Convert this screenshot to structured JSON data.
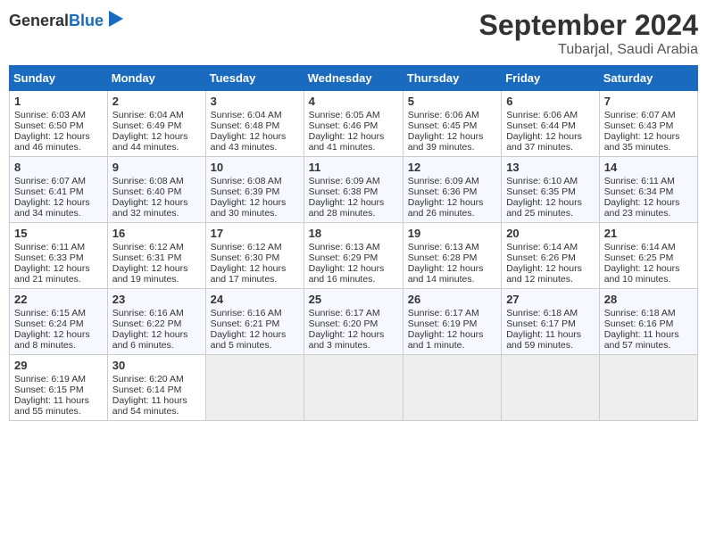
{
  "header": {
    "logo_general": "General",
    "logo_blue": "Blue",
    "month_title": "September 2024",
    "location": "Tubarjal, Saudi Arabia"
  },
  "calendar": {
    "days_of_week": [
      "Sunday",
      "Monday",
      "Tuesday",
      "Wednesday",
      "Thursday",
      "Friday",
      "Saturday"
    ],
    "weeks": [
      [
        {
          "day": 1,
          "sunrise": "Sunrise: 6:03 AM",
          "sunset": "Sunset: 6:50 PM",
          "daylight": "Daylight: 12 hours and 46 minutes."
        },
        {
          "day": 2,
          "sunrise": "Sunrise: 6:04 AM",
          "sunset": "Sunset: 6:49 PM",
          "daylight": "Daylight: 12 hours and 44 minutes."
        },
        {
          "day": 3,
          "sunrise": "Sunrise: 6:04 AM",
          "sunset": "Sunset: 6:48 PM",
          "daylight": "Daylight: 12 hours and 43 minutes."
        },
        {
          "day": 4,
          "sunrise": "Sunrise: 6:05 AM",
          "sunset": "Sunset: 6:46 PM",
          "daylight": "Daylight: 12 hours and 41 minutes."
        },
        {
          "day": 5,
          "sunrise": "Sunrise: 6:06 AM",
          "sunset": "Sunset: 6:45 PM",
          "daylight": "Daylight: 12 hours and 39 minutes."
        },
        {
          "day": 6,
          "sunrise": "Sunrise: 6:06 AM",
          "sunset": "Sunset: 6:44 PM",
          "daylight": "Daylight: 12 hours and 37 minutes."
        },
        {
          "day": 7,
          "sunrise": "Sunrise: 6:07 AM",
          "sunset": "Sunset: 6:43 PM",
          "daylight": "Daylight: 12 hours and 35 minutes."
        }
      ],
      [
        {
          "day": 8,
          "sunrise": "Sunrise: 6:07 AM",
          "sunset": "Sunset: 6:41 PM",
          "daylight": "Daylight: 12 hours and 34 minutes."
        },
        {
          "day": 9,
          "sunrise": "Sunrise: 6:08 AM",
          "sunset": "Sunset: 6:40 PM",
          "daylight": "Daylight: 12 hours and 32 minutes."
        },
        {
          "day": 10,
          "sunrise": "Sunrise: 6:08 AM",
          "sunset": "Sunset: 6:39 PM",
          "daylight": "Daylight: 12 hours and 30 minutes."
        },
        {
          "day": 11,
          "sunrise": "Sunrise: 6:09 AM",
          "sunset": "Sunset: 6:38 PM",
          "daylight": "Daylight: 12 hours and 28 minutes."
        },
        {
          "day": 12,
          "sunrise": "Sunrise: 6:09 AM",
          "sunset": "Sunset: 6:36 PM",
          "daylight": "Daylight: 12 hours and 26 minutes."
        },
        {
          "day": 13,
          "sunrise": "Sunrise: 6:10 AM",
          "sunset": "Sunset: 6:35 PM",
          "daylight": "Daylight: 12 hours and 25 minutes."
        },
        {
          "day": 14,
          "sunrise": "Sunrise: 6:11 AM",
          "sunset": "Sunset: 6:34 PM",
          "daylight": "Daylight: 12 hours and 23 minutes."
        }
      ],
      [
        {
          "day": 15,
          "sunrise": "Sunrise: 6:11 AM",
          "sunset": "Sunset: 6:33 PM",
          "daylight": "Daylight: 12 hours and 21 minutes."
        },
        {
          "day": 16,
          "sunrise": "Sunrise: 6:12 AM",
          "sunset": "Sunset: 6:31 PM",
          "daylight": "Daylight: 12 hours and 19 minutes."
        },
        {
          "day": 17,
          "sunrise": "Sunrise: 6:12 AM",
          "sunset": "Sunset: 6:30 PM",
          "daylight": "Daylight: 12 hours and 17 minutes."
        },
        {
          "day": 18,
          "sunrise": "Sunrise: 6:13 AM",
          "sunset": "Sunset: 6:29 PM",
          "daylight": "Daylight: 12 hours and 16 minutes."
        },
        {
          "day": 19,
          "sunrise": "Sunrise: 6:13 AM",
          "sunset": "Sunset: 6:28 PM",
          "daylight": "Daylight: 12 hours and 14 minutes."
        },
        {
          "day": 20,
          "sunrise": "Sunrise: 6:14 AM",
          "sunset": "Sunset: 6:26 PM",
          "daylight": "Daylight: 12 hours and 12 minutes."
        },
        {
          "day": 21,
          "sunrise": "Sunrise: 6:14 AM",
          "sunset": "Sunset: 6:25 PM",
          "daylight": "Daylight: 12 hours and 10 minutes."
        }
      ],
      [
        {
          "day": 22,
          "sunrise": "Sunrise: 6:15 AM",
          "sunset": "Sunset: 6:24 PM",
          "daylight": "Daylight: 12 hours and 8 minutes."
        },
        {
          "day": 23,
          "sunrise": "Sunrise: 6:16 AM",
          "sunset": "Sunset: 6:22 PM",
          "daylight": "Daylight: 12 hours and 6 minutes."
        },
        {
          "day": 24,
          "sunrise": "Sunrise: 6:16 AM",
          "sunset": "Sunset: 6:21 PM",
          "daylight": "Daylight: 12 hours and 5 minutes."
        },
        {
          "day": 25,
          "sunrise": "Sunrise: 6:17 AM",
          "sunset": "Sunset: 6:20 PM",
          "daylight": "Daylight: 12 hours and 3 minutes."
        },
        {
          "day": 26,
          "sunrise": "Sunrise: 6:17 AM",
          "sunset": "Sunset: 6:19 PM",
          "daylight": "Daylight: 12 hours and 1 minute."
        },
        {
          "day": 27,
          "sunrise": "Sunrise: 6:18 AM",
          "sunset": "Sunset: 6:17 PM",
          "daylight": "Daylight: 11 hours and 59 minutes."
        },
        {
          "day": 28,
          "sunrise": "Sunrise: 6:18 AM",
          "sunset": "Sunset: 6:16 PM",
          "daylight": "Daylight: 11 hours and 57 minutes."
        }
      ],
      [
        {
          "day": 29,
          "sunrise": "Sunrise: 6:19 AM",
          "sunset": "Sunset: 6:15 PM",
          "daylight": "Daylight: 11 hours and 55 minutes."
        },
        {
          "day": 30,
          "sunrise": "Sunrise: 6:20 AM",
          "sunset": "Sunset: 6:14 PM",
          "daylight": "Daylight: 11 hours and 54 minutes."
        },
        null,
        null,
        null,
        null,
        null
      ]
    ]
  }
}
